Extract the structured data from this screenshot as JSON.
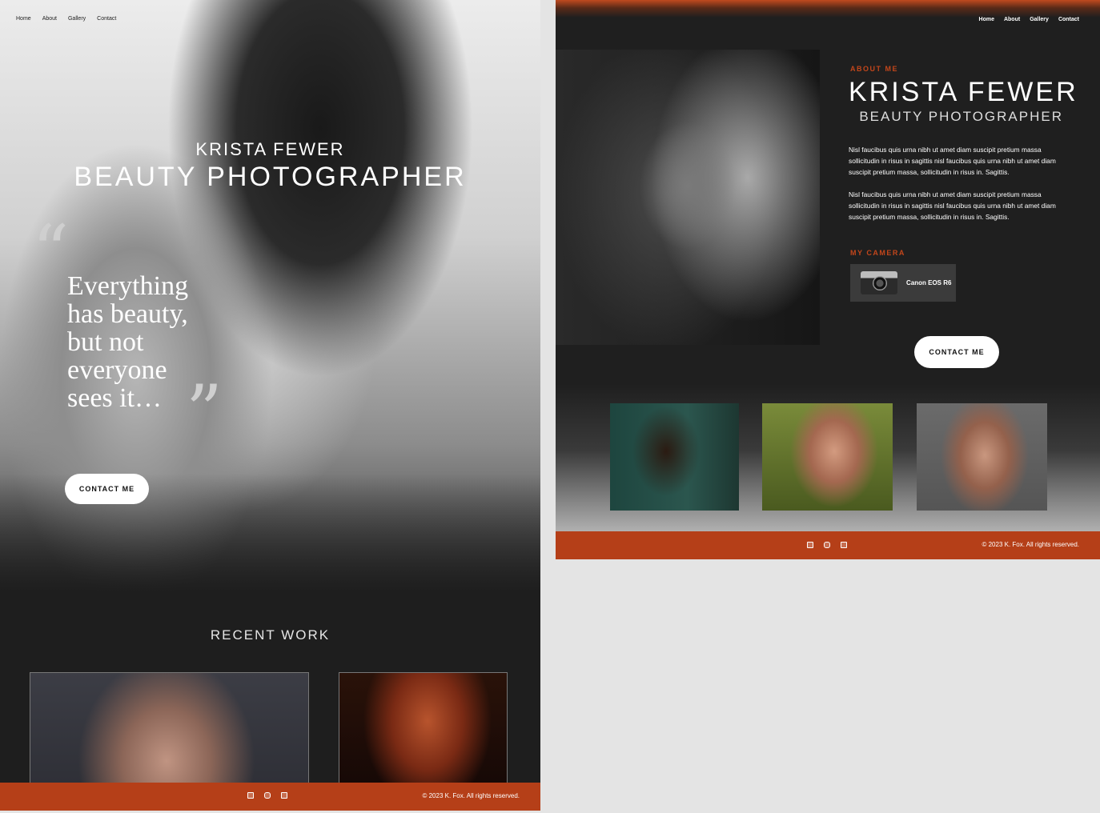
{
  "left": {
    "nav": [
      "Home",
      "About",
      "Gallery",
      "Contact"
    ],
    "name": "KRISTA FEWER",
    "title": "BEAUTY PHOTOGRAPHER",
    "quote_open": "“",
    "quote": "Everything has beauty, but not everyone sees it…",
    "quote_close": "”",
    "cta": "CONTACT ME",
    "recent_heading": "RECENT WORK",
    "footer_icons": [
      "facebook-icon",
      "instagram-icon",
      "linkedin-icon"
    ],
    "copyright": "© 2023 K. Fox. All rights reserved."
  },
  "right": {
    "nav": [
      "Home",
      "About",
      "Gallery",
      "Contact"
    ],
    "about_label": "ABOUT ME",
    "name": "KRISTA FEWER",
    "title": "BEAUTY PHOTOGRAPHER",
    "paragraphs": [
      "Nisl faucibus quis urna nibh ut amet diam suscipit pretium massa sollicitudin in risus in sagittis nisl faucibus quis urna nibh ut amet diam suscipit pretium massa, sollicitudin in risus in. Sagittis.",
      "Nisl faucibus quis urna nibh ut amet diam suscipit pretium massa sollicitudin in risus in sagittis nisl faucibus quis urna nibh ut amet diam suscipit pretium massa, sollicitudin in risus in. Sagittis."
    ],
    "camera_label": "MY CAMERA",
    "camera_name": "Canon EOS R6",
    "cta": "CONTACT ME",
    "footer_icons": [
      "facebook-icon",
      "instagram-icon",
      "linkedin-icon"
    ],
    "copyright": "© 2023 K. Fox. All rights reserved."
  },
  "colors": {
    "accent": "#b53f18",
    "dark_bg": "#1e1e1e",
    "label_orange": "#c2461b"
  }
}
